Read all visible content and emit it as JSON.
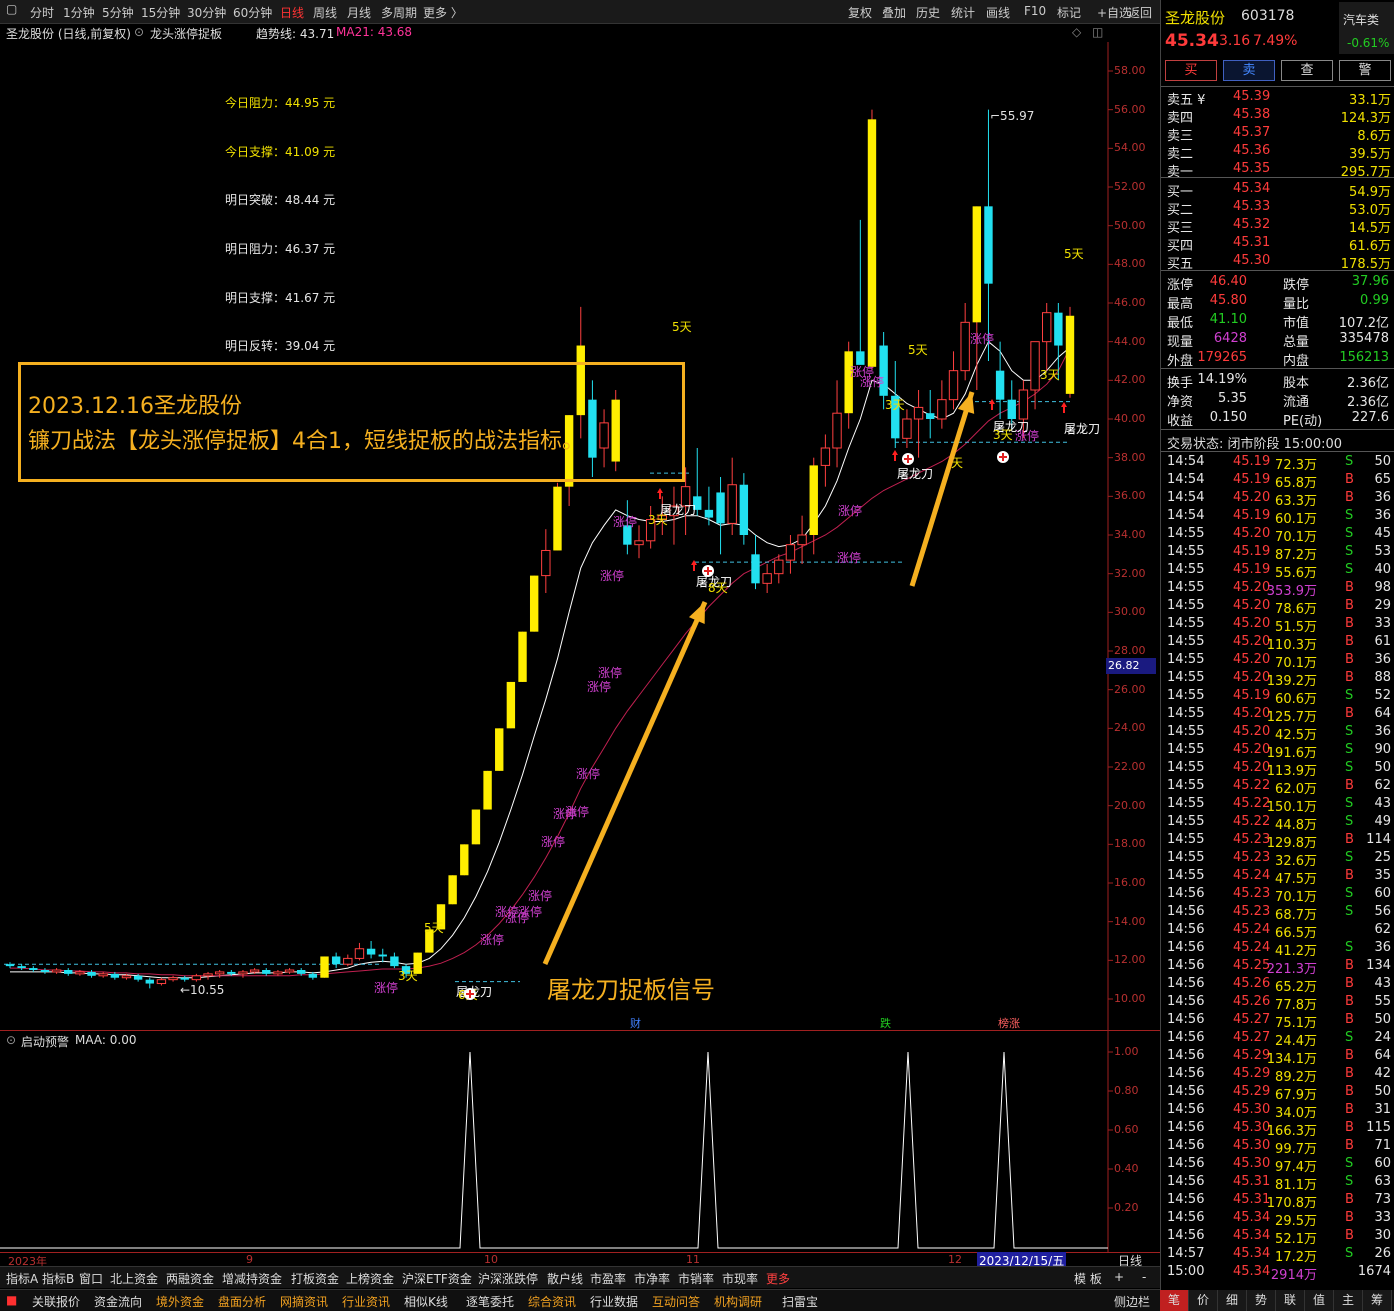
{
  "toolbar": {
    "periods": [
      "分时",
      "1分钟",
      "5分钟",
      "15分钟",
      "30分钟",
      "60分钟",
      "日线",
      "周线",
      "月线",
      "多周期",
      "更多 〉"
    ],
    "active_period": "日线",
    "right_items": [
      "复权",
      "叠加",
      "历史",
      "统计",
      "画线",
      "F10",
      "标记",
      "+自选",
      "返回"
    ]
  },
  "chart_header": {
    "stock_label": "圣龙股份 (日线,前复权)",
    "indicator_name": "龙头涨停捉板",
    "trend_label": "趋势线: 43.71",
    "ma_label": "MA21: 43.68"
  },
  "levels": [
    {
      "label": "今日阻力：44.95 元",
      "color": "#f0e000"
    },
    {
      "label": "今日支撑：41.09 元",
      "color": "#f0e000"
    },
    {
      "label": "明日突破：48.44 元",
      "color": "#e6e6e6"
    },
    {
      "label": "明日阻力：46.37 元",
      "color": "#e6e6e6"
    },
    {
      "label": "明日支撑：41.67 元",
      "color": "#e6e6e6"
    },
    {
      "label": "明日反转：39.04 元",
      "color": "#e6e6e6"
    }
  ],
  "annotation": {
    "line1": "2023.12.16圣龙股份",
    "line2": "镰刀战法【龙头涨停捉板】4合1，短线捉板的战法指标。",
    "signal": "屠龙刀捉板信号"
  },
  "price_axis": [
    "58.00",
    "56.00",
    "54.00",
    "52.00",
    "50.00",
    "48.00",
    "46.00",
    "44.00",
    "42.00",
    "40.00",
    "38.00",
    "36.00",
    "34.00",
    "32.00",
    "30.00",
    "28.00",
    "26.00",
    "24.00",
    "22.00",
    "20.00",
    "18.00",
    "16.00",
    "14.00",
    "12.00",
    "10.00"
  ],
  "current_price_tag": "26.82",
  "chart_labels": {
    "high": "55.97",
    "low": "10.55",
    "zt": "涨停",
    "tlk": "屠龙刀",
    "d5": "5天",
    "d3": "3天",
    "d8": "8天",
    "d6": "6天",
    "tian": "天",
    "cai": "财",
    "die": "跌",
    "bangzhang": "榜涨"
  },
  "indicator": {
    "title": "启动预警",
    "value_label": "MAA: 0.00",
    "axis": [
      "1.00",
      "0.80",
      "0.60",
      "0.40",
      "0.20"
    ]
  },
  "time_axis": [
    "2023年",
    "9",
    "10",
    "11",
    "12",
    "2023/12/15/五"
  ],
  "period_label": "日线",
  "quote": {
    "name": "圣龙股份",
    "code": "603178",
    "sector": "汽车类",
    "price": "45.34",
    "change": "3.16",
    "pct": "7.49%",
    "sector_pct": "-0.61%",
    "buttons": [
      "买",
      "卖",
      "查",
      "警"
    ],
    "asks": [
      {
        "label": "卖五 ¥",
        "price": "45.39",
        "vol": "33.1万"
      },
      {
        "label": "卖四",
        "price": "45.38",
        "vol": "124.3万"
      },
      {
        "label": "卖三",
        "price": "45.37",
        "vol": "8.6万"
      },
      {
        "label": "卖二",
        "price": "45.36",
        "vol": "39.5万"
      },
      {
        "label": "卖一",
        "price": "45.35",
        "vol": "295.7万"
      }
    ],
    "bids": [
      {
        "label": "买一",
        "price": "45.34",
        "vol": "54.9万"
      },
      {
        "label": "买二",
        "price": "45.33",
        "vol": "53.0万"
      },
      {
        "label": "买三",
        "price": "45.32",
        "vol": "14.5万"
      },
      {
        "label": "买四",
        "price": "45.31",
        "vol": "61.6万"
      },
      {
        "label": "买五",
        "price": "45.30",
        "vol": "178.5万"
      }
    ],
    "stats": [
      {
        "l1": "涨停",
        "v1": "46.40",
        "c1": "up",
        "l2": "跌停",
        "v2": "37.96",
        "c2": "down"
      },
      {
        "l1": "最高",
        "v1": "45.80",
        "c1": "up",
        "l2": "量比",
        "v2": "0.99",
        "c2": "down"
      },
      {
        "l1": "最低",
        "v1": "41.10",
        "c1": "down",
        "l2": "市值",
        "v2": "107.2亿",
        "c2": "wht"
      },
      {
        "l1": "现量",
        "v1": "6428",
        "c1": "mag",
        "l2": "总量",
        "v2": "335478",
        "c2": "wht"
      },
      {
        "l1": "外盘",
        "v1": "179265",
        "c1": "up",
        "l2": "内盘",
        "v2": "156213",
        "c2": "down"
      }
    ],
    "stats2": [
      {
        "l1": "换手",
        "v1": "14.19%",
        "l2": "股本",
        "v2": "2.36亿"
      },
      {
        "l1": "净资",
        "v1": "5.35",
        "l2": "流通",
        "v2": "2.36亿"
      },
      {
        "l1": "收益",
        "v1": "0.150",
        "l2": "PE(动)",
        "v2": "227.6"
      }
    ],
    "trade_status": "交易状态: 闭市阶段 15:00:00"
  },
  "ticks": [
    [
      "14:54",
      "45.19",
      "72.3万",
      "S",
      "50"
    ],
    [
      "14:54",
      "45.19",
      "65.8万",
      "B",
      "65"
    ],
    [
      "14:54",
      "45.20",
      "63.3万",
      "B",
      "36"
    ],
    [
      "14:54",
      "45.19",
      "60.1万",
      "S",
      "36"
    ],
    [
      "14:55",
      "45.20",
      "70.1万",
      "S",
      "45"
    ],
    [
      "14:55",
      "45.19",
      "87.2万",
      "S",
      "53"
    ],
    [
      "14:55",
      "45.19",
      "55.6万",
      "S",
      "40"
    ],
    [
      "14:55",
      "45.20",
      "353.9万",
      "B",
      "98"
    ],
    [
      "14:55",
      "45.20",
      "78.6万",
      "B",
      "29"
    ],
    [
      "14:55",
      "45.20",
      "51.5万",
      "B",
      "33"
    ],
    [
      "14:55",
      "45.20",
      "110.3万",
      "B",
      "61"
    ],
    [
      "14:55",
      "45.20",
      "70.1万",
      "B",
      "36"
    ],
    [
      "14:55",
      "45.20",
      "139.2万",
      "B",
      "88"
    ],
    [
      "14:55",
      "45.19",
      "60.6万",
      "S",
      "52"
    ],
    [
      "14:55",
      "45.20",
      "125.7万",
      "B",
      "64"
    ],
    [
      "14:55",
      "45.20",
      "42.5万",
      "S",
      "36"
    ],
    [
      "14:55",
      "45.20",
      "191.6万",
      "S",
      "90"
    ],
    [
      "14:55",
      "45.20",
      "113.9万",
      "S",
      "50"
    ],
    [
      "14:55",
      "45.22",
      "62.0万",
      "B",
      "62"
    ],
    [
      "14:55",
      "45.22",
      "150.1万",
      "S",
      "43"
    ],
    [
      "14:55",
      "45.22",
      "44.8万",
      "S",
      "49"
    ],
    [
      "14:55",
      "45.23",
      "129.8万",
      "B",
      "114"
    ],
    [
      "14:55",
      "45.23",
      "32.6万",
      "S",
      "25"
    ],
    [
      "14:55",
      "45.24",
      "47.5万",
      "B",
      "35"
    ],
    [
      "14:56",
      "45.23",
      "70.1万",
      "S",
      "60"
    ],
    [
      "14:56",
      "45.23",
      "68.7万",
      "S",
      "56"
    ],
    [
      "14:56",
      "45.24",
      "66.5万",
      "",
      "62"
    ],
    [
      "14:56",
      "45.24",
      "41.2万",
      "S",
      "36"
    ],
    [
      "14:56",
      "45.25",
      "221.3万",
      "B",
      "134"
    ],
    [
      "14:56",
      "45.26",
      "65.2万",
      "B",
      "43"
    ],
    [
      "14:56",
      "45.26",
      "77.8万",
      "B",
      "55"
    ],
    [
      "14:56",
      "45.27",
      "75.1万",
      "B",
      "50"
    ],
    [
      "14:56",
      "45.27",
      "24.4万",
      "S",
      "24"
    ],
    [
      "14:56",
      "45.29",
      "134.1万",
      "B",
      "64"
    ],
    [
      "14:56",
      "45.29",
      "89.2万",
      "B",
      "42"
    ],
    [
      "14:56",
      "45.29",
      "67.9万",
      "B",
      "50"
    ],
    [
      "14:56",
      "45.30",
      "34.0万",
      "B",
      "31"
    ],
    [
      "14:56",
      "45.30",
      "166.3万",
      "B",
      "115"
    ],
    [
      "14:56",
      "45.30",
      "99.7万",
      "B",
      "71"
    ],
    [
      "14:56",
      "45.30",
      "97.4万",
      "S",
      "60"
    ],
    [
      "14:56",
      "45.31",
      "81.1万",
      "S",
      "63"
    ],
    [
      "14:56",
      "45.31",
      "170.8万",
      "B",
      "73"
    ],
    [
      "14:56",
      "45.34",
      "29.5万",
      "B",
      "33"
    ],
    [
      "14:56",
      "45.34",
      "52.1万",
      "B",
      "30"
    ],
    [
      "14:57",
      "45.34",
      "17.2万",
      "S",
      "26"
    ],
    [
      "15:00",
      "45.34",
      "2914万",
      "",
      "1674"
    ]
  ],
  "bottom_tabs1": [
    "指标A",
    "指标B",
    "窗口",
    "北上资金",
    "两融资金",
    "增减持资金",
    "打板资金",
    "上榜资金",
    "沪深ETF资金",
    "沪深涨跌停",
    "散户线",
    "市盈率",
    "市净率",
    "市销率",
    "市现率",
    "更多"
  ],
  "bottom_right1": [
    "模 板",
    "+",
    "-"
  ],
  "bottom_tabs2": [
    {
      "t": "关联报价",
      "c": "#ddd"
    },
    {
      "t": "资金流向",
      "c": "#ddd"
    },
    {
      "t": "境外资金",
      "c": "#f0a020"
    },
    {
      "t": "盘面分析",
      "c": "#f0a020"
    },
    {
      "t": "网摘资讯",
      "c": "#f0a020"
    },
    {
      "t": "行业资讯",
      "c": "#f0a020"
    },
    {
      "t": "相似K线",
      "c": "#ddd"
    },
    {
      "t": "逐笔委托",
      "c": "#ddd"
    },
    {
      "t": "综合资讯",
      "c": "#f0a020"
    },
    {
      "t": "行业数据",
      "c": "#ddd"
    },
    {
      "t": "互动问答",
      "c": "#f0a020"
    },
    {
      "t": "机构调研",
      "c": "#f0a020"
    },
    {
      "t": "扫雷宝",
      "c": "#ddd"
    }
  ],
  "sidebar_label": "侧边栏",
  "right_tabs": [
    "笔",
    "价",
    "细",
    "势",
    "联",
    "值",
    "主",
    "筹"
  ],
  "candles": [
    [
      11.8,
      11.9,
      11.6,
      11.7
    ],
    [
      11.7,
      11.8,
      11.5,
      11.6
    ],
    [
      11.6,
      11.7,
      11.4,
      11.5
    ],
    [
      11.5,
      11.6,
      11.3,
      11.4
    ],
    [
      11.4,
      11.6,
      11.3,
      11.5
    ],
    [
      11.5,
      11.6,
      11.2,
      11.3
    ],
    [
      11.3,
      11.5,
      11.2,
      11.4
    ],
    [
      11.4,
      11.5,
      11.1,
      11.2
    ],
    [
      11.2,
      11.4,
      11.1,
      11.3
    ],
    [
      11.3,
      11.4,
      11.0,
      11.1
    ],
    [
      11.1,
      11.3,
      11.0,
      11.2
    ],
    [
      11.2,
      11.3,
      10.9,
      11.0
    ],
    [
      11.0,
      11.1,
      10.55,
      10.8
    ],
    [
      10.8,
      11.1,
      10.7,
      11.0
    ],
    [
      11.0,
      11.2,
      10.9,
      11.1
    ],
    [
      11.1,
      11.2,
      10.9,
      11.0
    ],
    [
      11.0,
      11.3,
      10.9,
      11.2
    ],
    [
      11.2,
      11.4,
      11.0,
      11.3
    ],
    [
      11.3,
      11.5,
      11.1,
      11.4
    ],
    [
      11.4,
      11.5,
      11.2,
      11.3
    ],
    [
      11.3,
      11.5,
      11.1,
      11.4
    ],
    [
      11.4,
      11.6,
      11.3,
      11.5
    ],
    [
      11.5,
      11.6,
      11.2,
      11.3
    ],
    [
      11.3,
      11.5,
      11.2,
      11.4
    ],
    [
      11.4,
      11.6,
      11.3,
      11.5
    ],
    [
      11.5,
      11.6,
      11.2,
      11.3
    ],
    [
      11.3,
      11.4,
      11.0,
      11.1
    ],
    [
      11.1,
      12.2,
      11.1,
      12.2
    ],
    [
      12.2,
      12.4,
      11.6,
      11.8
    ],
    [
      11.8,
      12.3,
      11.7,
      12.1
    ],
    [
      12.1,
      12.9,
      12.0,
      12.6
    ],
    [
      12.6,
      13.0,
      12.1,
      12.3
    ],
    [
      12.3,
      12.6,
      11.9,
      12.2
    ],
    [
      12.2,
      12.4,
      11.6,
      11.7
    ],
    [
      11.7,
      11.8,
      11.1,
      11.3
    ],
    [
      11.3,
      12.4,
      11.3,
      12.4
    ],
    [
      12.4,
      13.6,
      12.4,
      13.6
    ],
    [
      13.6,
      14.9,
      13.6,
      14.9
    ],
    [
      14.9,
      16.4,
      14.9,
      16.4
    ],
    [
      16.4,
      18.0,
      16.4,
      18.0
    ],
    [
      18.0,
      19.8,
      18.0,
      19.8
    ],
    [
      19.8,
      21.8,
      19.8,
      21.8
    ],
    [
      21.8,
      24.0,
      21.8,
      24.0
    ],
    [
      24.0,
      26.4,
      24.0,
      26.4
    ],
    [
      26.4,
      29.0,
      26.4,
      29.0
    ],
    [
      29.0,
      31.9,
      29.0,
      31.9
    ],
    [
      31.9,
      34.3,
      31.0,
      33.2
    ],
    [
      33.2,
      36.7,
      33.2,
      36.5
    ],
    [
      36.5,
      40.2,
      35.5,
      40.2
    ],
    [
      40.2,
      45.8,
      39.0,
      43.8
    ],
    [
      41.0,
      42.0,
      37.0,
      38.0
    ],
    [
      38.5,
      40.5,
      37.5,
      39.8
    ],
    [
      37.8,
      41.5,
      37.3,
      41.0
    ],
    [
      34.5,
      35.8,
      33.0,
      33.5
    ],
    [
      33.5,
      34.5,
      32.8,
      33.7
    ],
    [
      33.7,
      35.5,
      33.3,
      34.8
    ],
    [
      34.8,
      36.0,
      34.0,
      35.0
    ],
    [
      35.0,
      36.5,
      33.5,
      35.5
    ],
    [
      35.5,
      37.5,
      34.0,
      36.5
    ],
    [
      36.0,
      38.5,
      35.0,
      35.3
    ],
    [
      35.3,
      36.5,
      34.5,
      34.9
    ],
    [
      36.2,
      37.0,
      33.0,
      34.6
    ],
    [
      34.6,
      38.0,
      34.0,
      36.6
    ],
    [
      36.6,
      37.2,
      33.5,
      34.0
    ],
    [
      33.0,
      34.0,
      31.2,
      31.5
    ],
    [
      31.5,
      32.5,
      31.0,
      32.0
    ],
    [
      32.0,
      33.0,
      31.5,
      32.7
    ],
    [
      32.7,
      34.0,
      32.0,
      33.5
    ],
    [
      33.5,
      35.0,
      32.5,
      34.0
    ],
    [
      34.0,
      38.0,
      33.0,
      37.6
    ],
    [
      37.6,
      39.2,
      36.5,
      38.5
    ],
    [
      38.5,
      42.0,
      37.5,
      40.3
    ],
    [
      40.3,
      44.0,
      39.5,
      43.5
    ],
    [
      43.5,
      50.3,
      43.0,
      42.8
    ],
    [
      42.7,
      56.0,
      42.5,
      55.5
    ],
    [
      43.8,
      44.5,
      40.5,
      41.2
    ],
    [
      41.2,
      43.0,
      38.5,
      39.0
    ],
    [
      39.0,
      40.5,
      38.5,
      40.0
    ],
    [
      40.0,
      41.5,
      38.0,
      40.6
    ],
    [
      40.3,
      41.5,
      39.0,
      40.0
    ],
    [
      40.0,
      42.0,
      39.5,
      41.0
    ],
    [
      41.0,
      43.5,
      40.5,
      42.5
    ],
    [
      42.5,
      46.0,
      42.0,
      45.0
    ],
    [
      45.0,
      51.0,
      41.5,
      51.0
    ],
    [
      51.0,
      56.0,
      43.0,
      47.0
    ],
    [
      42.5,
      44.0,
      40.0,
      41.0
    ],
    [
      41.0,
      42.0,
      39.5,
      40.0
    ],
    [
      40.0,
      42.0,
      39.0,
      41.5
    ],
    [
      41.5,
      44.0,
      40.5,
      44.0
    ],
    [
      44.0,
      46.0,
      42.5,
      45.5
    ],
    [
      45.5,
      46.0,
      42.0,
      43.8
    ],
    [
      41.3,
      45.8,
      41.1,
      45.34
    ]
  ],
  "trend_line": [
    11.4,
    11.4,
    11.4,
    11.4,
    11.4,
    11.35,
    11.35,
    11.3,
    11.3,
    11.25,
    11.25,
    11.2,
    11.15,
    11.1,
    11.1,
    11.1,
    11.1,
    11.15,
    11.2,
    11.25,
    11.3,
    11.35,
    11.35,
    11.35,
    11.4,
    11.4,
    11.35,
    11.4,
    11.5,
    11.6,
    11.8,
    11.9,
    11.95,
    11.9,
    11.8,
    11.85,
    12.1,
    12.6,
    13.3,
    14.2,
    15.3,
    16.6,
    18.1,
    19.8,
    21.6,
    23.6,
    25.5,
    27.6,
    30.0,
    32.3,
    33.6,
    34.5,
    35.3,
    35.0,
    34.8,
    34.7,
    34.7,
    34.8,
    35.0,
    35.0,
    34.8,
    34.5,
    34.6,
    34.5,
    34.0,
    33.6,
    33.4,
    33.5,
    33.8,
    34.6,
    35.5,
    36.8,
    38.5,
    40.0,
    42.0,
    41.8,
    41.3,
    40.8,
    40.5,
    40.2,
    40.0,
    40.3,
    41.3,
    42.8,
    44.0,
    43.5,
    42.5,
    42.0,
    42.0,
    42.5,
    43.2,
    43.71
  ],
  "ma21_line": [
    11.6,
    11.6,
    11.55,
    11.5,
    11.5,
    11.45,
    11.45,
    11.4,
    11.4,
    11.35,
    11.35,
    11.3,
    11.3,
    11.25,
    11.25,
    11.2,
    11.2,
    11.2,
    11.2,
    11.2,
    11.2,
    11.2,
    11.2,
    11.2,
    11.2,
    11.25,
    11.25,
    11.3,
    11.35,
    11.4,
    11.45,
    11.5,
    11.55,
    11.55,
    11.55,
    11.6,
    11.7,
    11.85,
    12.1,
    12.4,
    12.8,
    13.3,
    13.9,
    14.6,
    15.4,
    16.3,
    17.3,
    18.4,
    19.6,
    20.9,
    22.0,
    23.0,
    24.0,
    24.9,
    25.7,
    26.5,
    27.3,
    28.1,
    28.9,
    29.6,
    30.3,
    30.9,
    31.5,
    32.0,
    32.3,
    32.6,
    32.9,
    33.1,
    33.4,
    33.7,
    34.0,
    34.4,
    34.9,
    35.4,
    35.9,
    36.3,
    36.6,
    36.9,
    37.2,
    37.5,
    37.8,
    38.2,
    38.7,
    39.3,
    39.9,
    40.3,
    40.6,
    40.9,
    41.3,
    41.8,
    42.5,
    43.68
  ]
}
